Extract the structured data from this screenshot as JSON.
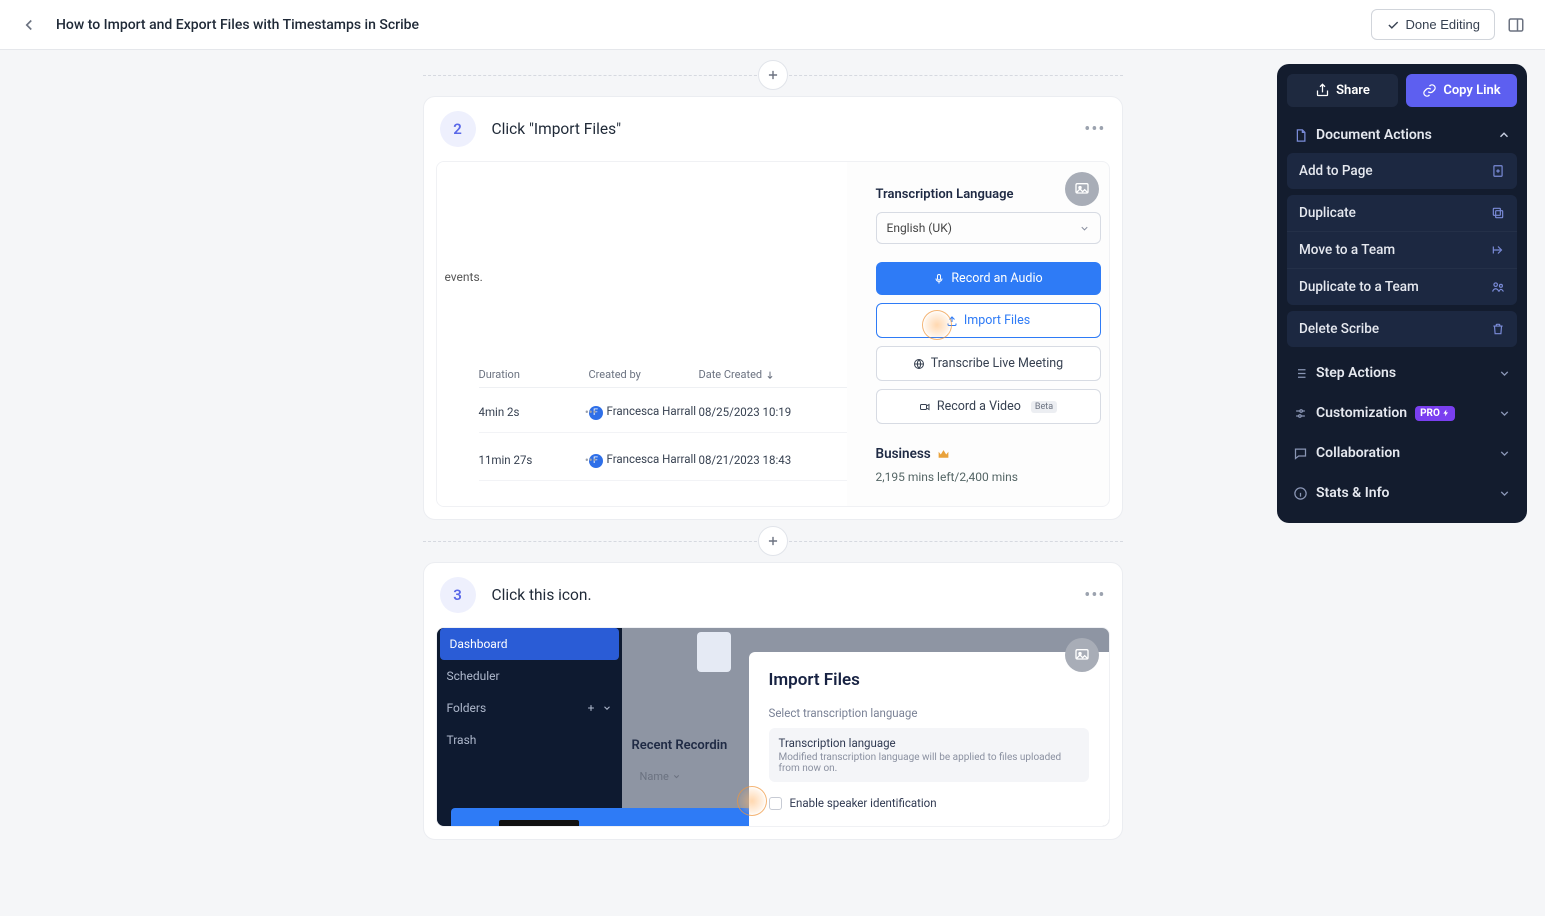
{
  "header": {
    "title": "How to Import and Export Files with Timestamps in Scribe",
    "done_label": "Done Editing"
  },
  "steps": [
    {
      "num": "2",
      "title": "Click \"Import Files\"",
      "shot1": {
        "events_text": "events.",
        "col_duration": "Duration",
        "col_created_by": "Created by",
        "col_date_created": "Date Created",
        "rows": [
          {
            "dur": "4min 2s",
            "avatar": "F",
            "name": "Francesca Harrall",
            "date": "08/25/2023 10:19"
          },
          {
            "dur": "11min 27s",
            "avatar": "F",
            "name": "Francesca Harrall",
            "date": "08/21/2023 18:43"
          }
        ],
        "right": {
          "lang_label": "Transcription Language",
          "lang_value": "English (UK)",
          "btn_record": "Record an Audio",
          "btn_import": "Import Files",
          "btn_live": "Transcribe Live Meeting",
          "btn_video": "Record a Video",
          "beta": "Beta",
          "biz_title": "Business",
          "biz_sub": "2,195 mins left/2,400 mins"
        }
      }
    },
    {
      "num": "3",
      "title": "Click this icon.",
      "shot2": {
        "nav": {
          "dashboard": "Dashboard",
          "scheduler": "Scheduler",
          "folders": "Folders",
          "trash": "Trash"
        },
        "recent": "Recent Recordin",
        "name_col": "Name",
        "modal": {
          "title": "Import Files",
          "sub": "Select transcription language",
          "lang_t": "Transcription language",
          "lang_d": "Modified transcription language will be applied to files uploaded from now on.",
          "chk_label": "Enable speaker identification"
        }
      }
    }
  ],
  "panel": {
    "share": "Share",
    "copy": "Copy Link",
    "doc_actions": "Document Actions",
    "add_page": "Add to Page",
    "duplicate": "Duplicate",
    "move_team": "Move to a Team",
    "dup_team": "Duplicate to a Team",
    "delete": "Delete Scribe",
    "step_actions": "Step Actions",
    "customization": "Customization",
    "pro": "PRO",
    "collaboration": "Collaboration",
    "stats": "Stats & Info"
  }
}
